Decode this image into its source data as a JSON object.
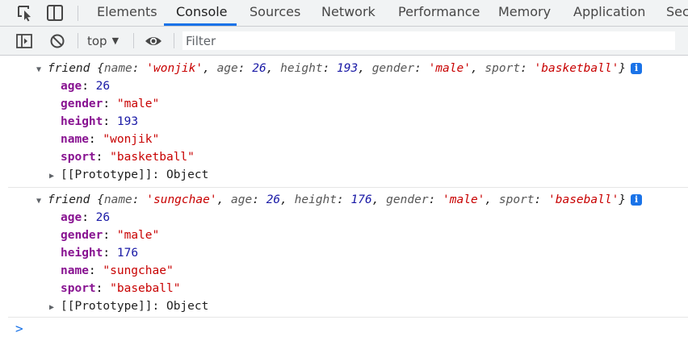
{
  "tabs": [
    "Elements",
    "Console",
    "Sources",
    "Network",
    "Performance",
    "Memory",
    "Application",
    "Sec"
  ],
  "active_tab": "Console",
  "toolbar": {
    "context": "top",
    "filter_placeholder": "Filter"
  },
  "colors": {
    "accent": "#1a73e8",
    "string": "#c80000",
    "number": "#1a1aa6",
    "property_key": "#881391"
  },
  "icons": {
    "inspect": "inspect-element-icon",
    "device": "device-toolbar-icon",
    "sidebar": "show-sidebar-icon",
    "clear": "clear-console-icon",
    "eye": "live-expression-icon",
    "info": "info-icon",
    "prompt": "chevron-right-icon"
  },
  "console": {
    "messages": [
      {
        "name": "friend",
        "preview": [
          {
            "key": "name",
            "value": "'wonjik'",
            "type": "str"
          },
          {
            "key": "age",
            "value": "26",
            "type": "num"
          },
          {
            "key": "height",
            "value": "193",
            "type": "num"
          },
          {
            "key": "gender",
            "value": "'male'",
            "type": "str"
          },
          {
            "key": "sport",
            "value": "'basketball'",
            "type": "str"
          }
        ],
        "properties": [
          {
            "key": "age",
            "value": "26",
            "type": "num"
          },
          {
            "key": "gender",
            "value": "\"male\"",
            "type": "str"
          },
          {
            "key": "height",
            "value": "193",
            "type": "num"
          },
          {
            "key": "name",
            "value": "\"wonjik\"",
            "type": "str"
          },
          {
            "key": "sport",
            "value": "\"basketball\"",
            "type": "str"
          }
        ],
        "prototype_label": "[[Prototype]]",
        "prototype_value": "Object"
      },
      {
        "name": "friend",
        "preview": [
          {
            "key": "name",
            "value": "'sungchae'",
            "type": "str"
          },
          {
            "key": "age",
            "value": "26",
            "type": "num"
          },
          {
            "key": "height",
            "value": "176",
            "type": "num"
          },
          {
            "key": "gender",
            "value": "'male'",
            "type": "str"
          },
          {
            "key": "sport",
            "value": "'baseball'",
            "type": "str"
          }
        ],
        "properties": [
          {
            "key": "age",
            "value": "26",
            "type": "num"
          },
          {
            "key": "gender",
            "value": "\"male\"",
            "type": "str"
          },
          {
            "key": "height",
            "value": "176",
            "type": "num"
          },
          {
            "key": "name",
            "value": "\"sungchae\"",
            "type": "str"
          },
          {
            "key": "sport",
            "value": "\"baseball\"",
            "type": "str"
          }
        ],
        "prototype_label": "[[Prototype]]",
        "prototype_value": "Object"
      }
    ],
    "prompt_symbol": ">"
  }
}
